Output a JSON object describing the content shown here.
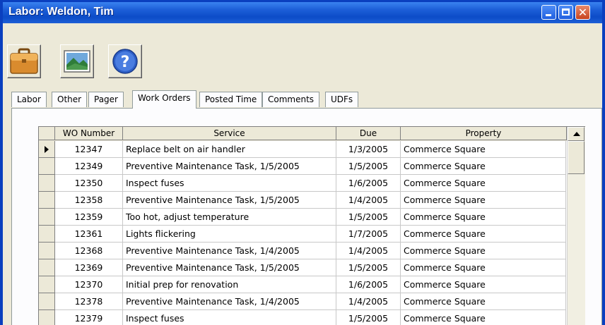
{
  "window": {
    "title": "Labor: Weldon, Tim",
    "controls": [
      "minimize",
      "maximize",
      "close"
    ],
    "close_glyph": "✕"
  },
  "toolbar": {
    "buttons": [
      {
        "icon": "briefcase-icon"
      },
      {
        "icon": "landscape-picture-icon"
      },
      {
        "icon": "help-icon",
        "glyph": "?"
      }
    ]
  },
  "tabs": [
    {
      "label": "Labor"
    },
    {
      "label": "Other"
    },
    {
      "label": "Pager"
    },
    {
      "label": "Work Orders",
      "active": true
    },
    {
      "label": "Posted Time"
    },
    {
      "label": "Comments"
    },
    {
      "label": "UDFs"
    }
  ],
  "table": {
    "columns": [
      "WO Number",
      "Service",
      "Due",
      "Property"
    ],
    "rows": [
      {
        "wo": "12347",
        "service": "Replace belt on air handler",
        "due": "1/3/2005",
        "property": "Commerce Square",
        "current": true
      },
      {
        "wo": "12349",
        "service": "Preventive Maintenance Task, 1/5/2005",
        "due": "1/5/2005",
        "property": "Commerce Square"
      },
      {
        "wo": "12350",
        "service": "Inspect fuses",
        "due": "1/6/2005",
        "property": "Commerce Square"
      },
      {
        "wo": "12358",
        "service": "Preventive Maintenance Task, 1/5/2005",
        "due": "1/4/2005",
        "property": "Commerce Square"
      },
      {
        "wo": "12359",
        "service": "Too hot, adjust temperature",
        "due": "1/5/2005",
        "property": "Commerce Square"
      },
      {
        "wo": "12361",
        "service": "Lights flickering",
        "due": "1/7/2005",
        "property": "Commerce Square"
      },
      {
        "wo": "12368",
        "service": "Preventive Maintenance Task, 1/4/2005",
        "due": "1/4/2005",
        "property": "Commerce Square"
      },
      {
        "wo": "12369",
        "service": "Preventive Maintenance Task, 1/5/2005",
        "due": "1/5/2005",
        "property": "Commerce Square"
      },
      {
        "wo": "12370",
        "service": "Initial prep for renovation",
        "due": "1/6/2005",
        "property": "Commerce Square"
      },
      {
        "wo": "12378",
        "service": "Preventive Maintenance Task, 1/4/2005",
        "due": "1/4/2005",
        "property": "Commerce Square"
      },
      {
        "wo": "12379",
        "service": "Inspect fuses",
        "due": "1/5/2005",
        "property": "Commerce Square"
      }
    ]
  },
  "colors": {
    "titlebar": "#0c4cc8",
    "window_face": "#ece9d8",
    "close_button": "#c8431e"
  }
}
